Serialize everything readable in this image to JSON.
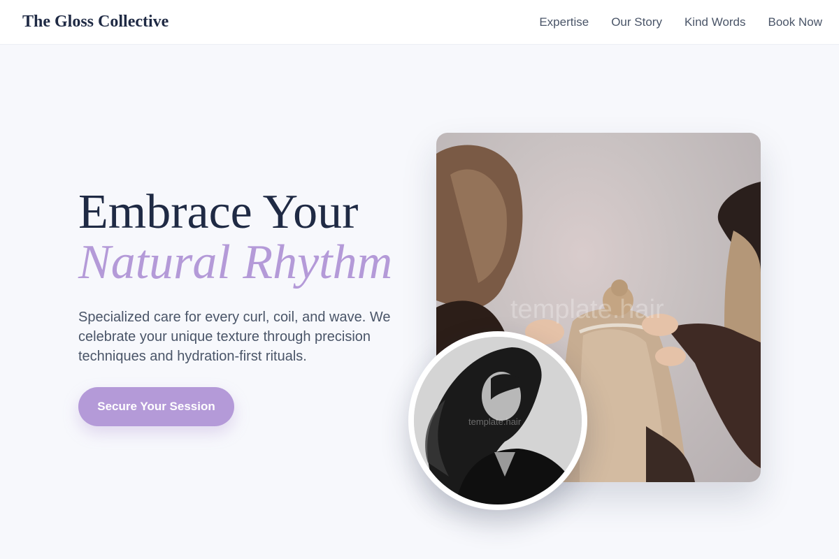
{
  "header": {
    "brand": "The Gloss Collective",
    "nav": [
      "Expertise",
      "Our Story",
      "Kind Words",
      "Book Now"
    ]
  },
  "hero": {
    "headline_line1": "Embrace Your",
    "headline_line2": "Natural Rhythm",
    "description": "Specialized care for every curl, coil, and wave. We celebrate your unique texture through precision techniques and hydration-first rituals.",
    "cta_label": "Secure Your Session"
  },
  "images": {
    "main_photo": "stylists-applying-hair-extensions",
    "main_watermark": "template.hair",
    "round_photo": "woman-with-flowing-dark-hair",
    "round_watermark": "template.hair"
  },
  "colors": {
    "accent": "#b49ad8",
    "heading": "#1f2a44",
    "body_text": "#4a5568",
    "background": "#f7f8fc"
  }
}
